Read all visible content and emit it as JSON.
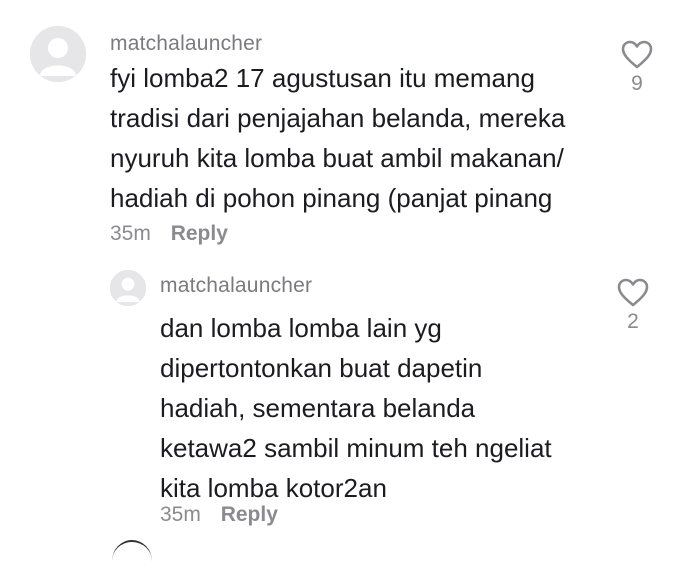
{
  "comments": [
    {
      "username": "matchalauncher",
      "lines": [
        "fyi lomba2 17 agustusan itu memang",
        "tradisi dari penjajahan belanda, mereka",
        "nyuruh kita lomba buat ambil makanan/",
        "hadiah di pohon pinang (panjat pinang"
      ],
      "time": "35m",
      "reply_label": "Reply",
      "likes": "9"
    },
    {
      "username": "matchalauncher",
      "lines": [
        "dan lomba lomba lain yg",
        "dipertontonkan buat dapetin",
        "hadiah, sementara belanda",
        "ketawa2 sambil minum teh ngeliat",
        "kita lomba kotor2an"
      ],
      "time": "35m",
      "reply_label": "Reply",
      "likes": "2"
    }
  ],
  "icons": {
    "avatar": "default-avatar-icon",
    "like": "heart-outline-icon"
  },
  "colors": {
    "text": "#1b1b22",
    "muted": "#8a8a90",
    "avatar_bg": "#e6e6e8"
  }
}
